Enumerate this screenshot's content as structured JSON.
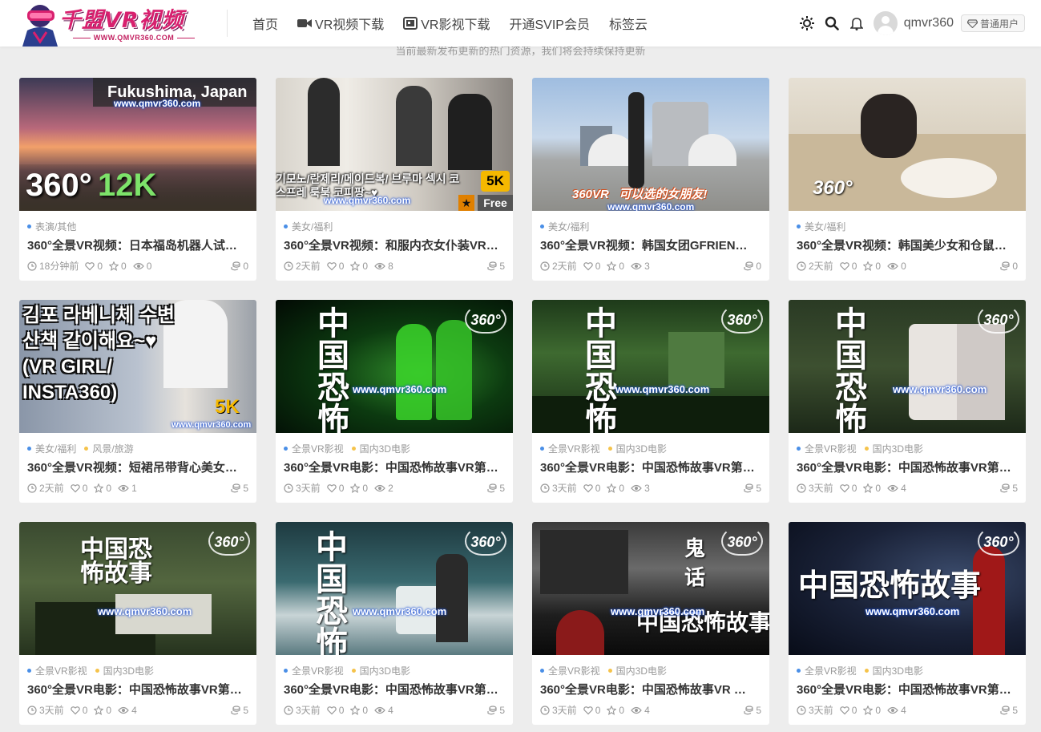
{
  "header": {
    "logo_title": "千盟VR视频",
    "logo_url": "WWW.QMVR360.COM",
    "nav": [
      {
        "label": "首页",
        "icon": ""
      },
      {
        "label": "VR视频下载",
        "icon": "video-camera-icon"
      },
      {
        "label": "VR影视下载",
        "icon": "film-icon"
      },
      {
        "label": "开通SVIP会员",
        "icon": ""
      },
      {
        "label": "标签云",
        "icon": ""
      }
    ],
    "username": "qmvr360",
    "user_badge": "普通用户"
  },
  "subtitle": "当前最新发布更新的热门资源，我们将会持续保持更新",
  "colors": {
    "dot_blue": "#4a8fe7",
    "dot_yellow": "#f5c34b",
    "logo_pink": "#d8206e"
  },
  "cards": [
    {
      "overlay": "Fukushima, Japan",
      "big_a": "360°",
      "big_b": "12K",
      "watermark": "www.qmvr360.com",
      "cats": [
        "表演/其他"
      ],
      "title": "360°全景VR视频：日本福岛机器人试飞…",
      "time": "18分钟前",
      "likes": "0",
      "favs": "0",
      "views": "0",
      "coins": "0"
    },
    {
      "overlay": "기모노/란제리/메이드복/ 브루마 섹시 코스프레 룩북 코피팡~♥",
      "badge_5k": "5K",
      "free": "Free",
      "watermark": "www.qmvr360.com",
      "cats": [
        "美女/福利"
      ],
      "title": "360°全景VR视频：和服内衣女仆装VR…",
      "time": "2天前",
      "likes": "0",
      "favs": "0",
      "views": "8",
      "coins": "5"
    },
    {
      "overlay": "360VR   可以选的女朋友!",
      "watermark": "www.qmvr360.com",
      "cats": [
        "美女/福利"
      ],
      "title": "360°全景VR视频：韩国女团GFRIEN…",
      "time": "2天前",
      "likes": "0",
      "favs": "0",
      "views": "3",
      "coins": "0"
    },
    {
      "overlay": "360°",
      "cats": [
        "美女/福利"
      ],
      "title": "360°全景VR视频：韩国美少女和仓鼠…",
      "time": "2天前",
      "likes": "0",
      "favs": "0",
      "views": "0",
      "coins": "0"
    },
    {
      "overlay": "김포 라베니체 수변 산책 같이해요~♥ (VR GIRL/ INSTA360)",
      "badge_5k": "5K",
      "watermark": "www.qmvr360.com",
      "cats": [
        "美女/福利",
        "风景/旅游"
      ],
      "title": "360°全景VR视频：短裙吊带背心美女…",
      "time": "2天前",
      "likes": "0",
      "favs": "0",
      "views": "1",
      "coins": "5"
    },
    {
      "cn": "中国恐怖故事",
      "watermark": "www.qmvr360.com",
      "b360": "360°",
      "cats": [
        "全景VR影视",
        "国内3D电影"
      ],
      "title": "360°全景VR电影：中国恐怖故事VR第…",
      "time": "3天前",
      "likes": "0",
      "favs": "0",
      "views": "2",
      "coins": "5"
    },
    {
      "cn": "中国恐怖故事",
      "watermark": "www.qmvr360.com",
      "b360": "360°",
      "cats": [
        "全景VR影视",
        "国内3D电影"
      ],
      "title": "360°全景VR电影：中国恐怖故事VR第…",
      "time": "3天前",
      "likes": "0",
      "favs": "0",
      "views": "3",
      "coins": "5"
    },
    {
      "cn": "中国恐怖故事",
      "watermark": "www.qmvr360.com",
      "b360": "360°",
      "cats": [
        "全景VR影视",
        "国内3D电影"
      ],
      "title": "360°全景VR电影：中国恐怖故事VR第…",
      "time": "3天前",
      "likes": "0",
      "favs": "0",
      "views": "4",
      "coins": "5"
    },
    {
      "cn": "中国恐怖故事",
      "watermark": "www.qmvr360.com",
      "b360": "360°",
      "cats": [
        "全景VR影视",
        "国内3D电影"
      ],
      "title": "360°全景VR电影：中国恐怖故事VR第…",
      "time": "3天前",
      "likes": "0",
      "favs": "0",
      "views": "4",
      "coins": "5"
    },
    {
      "cn": "中国恐怖故事",
      "watermark": "www.qmvr360.com",
      "b360": "360°",
      "cats": [
        "全景VR影视",
        "国内3D电影"
      ],
      "title": "360°全景VR电影：中国恐怖故事VR第…",
      "time": "3天前",
      "likes": "0",
      "favs": "0",
      "views": "4",
      "coins": "5"
    },
    {
      "cn": "中国恐怖故事",
      "cn2": "鬼 话",
      "watermark": "www.qmvr360.com",
      "b360": "360°",
      "cats": [
        "全景VR影视",
        "国内3D电影"
      ],
      "title": "360°全景VR电影：中国恐怖故事VR …",
      "time": "3天前",
      "likes": "0",
      "favs": "0",
      "views": "4",
      "coins": "5"
    },
    {
      "cn": "中国恐怖故事",
      "watermark": "www.qmvr360.com",
      "b360": "360°",
      "cats": [
        "全景VR影视",
        "国内3D电影"
      ],
      "title": "360°全景VR电影：中国恐怖故事VR第…",
      "time": "3天前",
      "likes": "0",
      "favs": "0",
      "views": "4",
      "coins": "5"
    }
  ]
}
